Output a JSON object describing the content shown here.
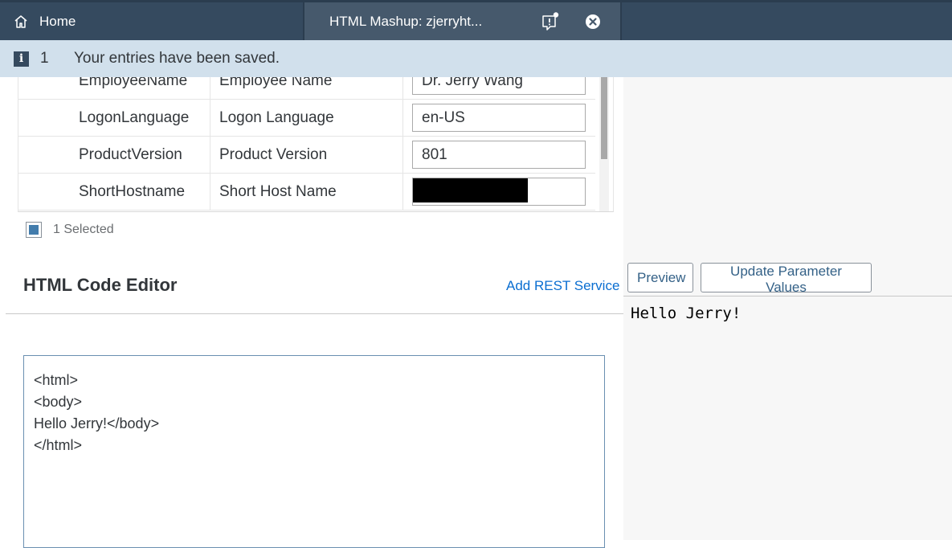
{
  "shell": {
    "home_label": "Home",
    "active_tab_title": "HTML Mashup: zjerryht...",
    "icons": {
      "home": "home-icon",
      "notification": "notification-icon",
      "close": "close-icon"
    }
  },
  "message_strip": {
    "icon": "info-icon",
    "icon_glyph": "i",
    "count": "1",
    "text": "Your entries have been saved."
  },
  "parameters_table": {
    "rows": [
      {
        "name": "EmployeeName",
        "description": "Employee Name",
        "value": "Dr. Jerry Wang"
      },
      {
        "name": "LogonLanguage",
        "description": "Logon Language",
        "value": "en-US"
      },
      {
        "name": "ProductVersion",
        "description": "Product Version",
        "value": "801"
      },
      {
        "name": "ShortHostname",
        "description": "Short Host Name",
        "value": ""
      }
    ],
    "selection_text": "1 Selected"
  },
  "editor": {
    "title": "HTML Code Editor",
    "add_rest_label": "Add REST Service",
    "code_lines": [
      "<html>",
      "<body>",
      "Hello Jerry!</body>",
      "</html>"
    ]
  },
  "preview": {
    "preview_button": "Preview",
    "update_button": "Update Parameter Values",
    "output_text": "Hello Jerry!"
  },
  "colors": {
    "shell_bg": "#354a5f",
    "message_strip_bg": "#d1e0ec",
    "link": "#0a6ed1",
    "button_text": "#346187"
  }
}
